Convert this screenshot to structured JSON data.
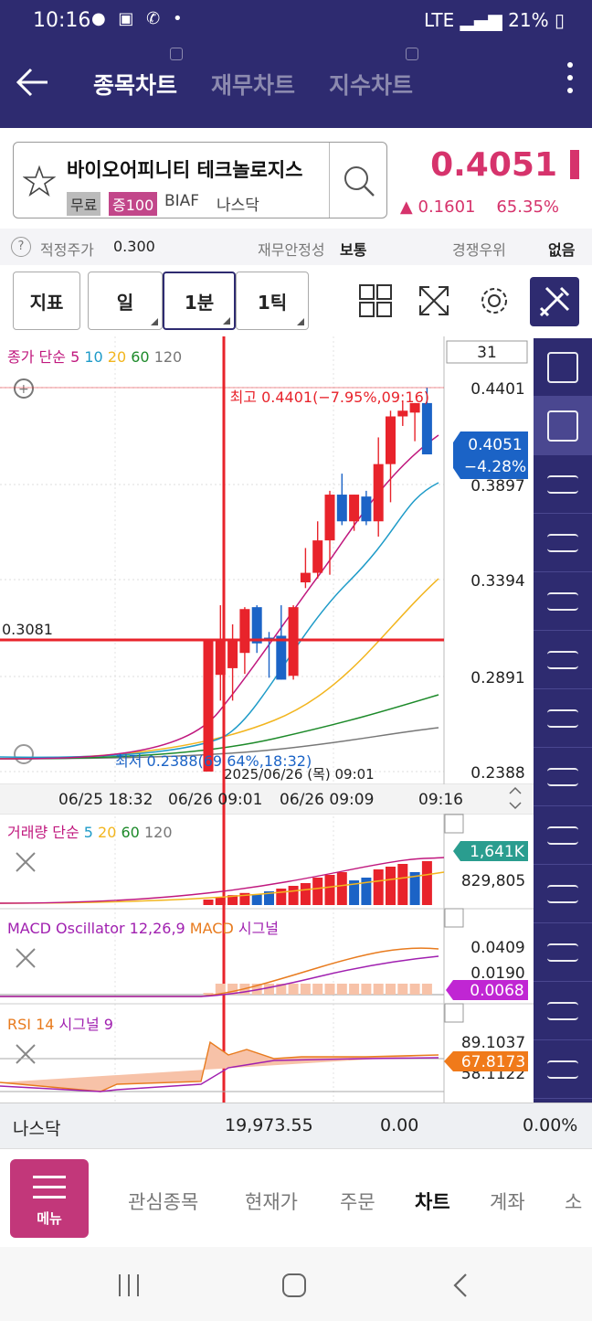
{
  "status_bar": {
    "time": "10:16",
    "battery": "21%",
    "network": "LTE"
  },
  "header": {
    "tabs": [
      {
        "label": "종목차트",
        "active": true
      },
      {
        "label": "재무차트",
        "active": false
      },
      {
        "label": "지수차트",
        "active": false
      }
    ]
  },
  "stock": {
    "name": "바이오어피니티 테크놀로지스",
    "tag_free": "무료",
    "tag_margin": "증100",
    "ticker": "BIAF",
    "market": "나스닥",
    "price": "0.4051",
    "change": "▲ 0.1601",
    "change_pct": "65.35%"
  },
  "info_row": {
    "fair_price_label": "적정주가",
    "fair_price_value": "0.300",
    "stability_label": "재무안정성",
    "stability_value": "보통",
    "rank_label": "경쟁우위",
    "rank_value": "없음"
  },
  "toolbar": {
    "indicator": "지표",
    "day": "일",
    "minute": "1분",
    "tick": "1틱"
  },
  "price_chart": {
    "ma_legend_prefix": "종가 단순",
    "ma_periods": [
      "5",
      "10",
      "20",
      "60",
      "120"
    ],
    "ma_colors": [
      "#c0187e",
      "#1e9bc8",
      "#f2b51e",
      "#1d8a2a",
      "#777777"
    ],
    "count_box": "31",
    "y_labels": [
      "0.4401",
      "0.3897",
      "0.3394",
      "0.2891",
      "0.2388"
    ],
    "cursor_price": "0.3081",
    "high_label": "최고 0.4401(−7.95%,09:16)",
    "low_label": "최저 0.2388(69.64%,18:32)",
    "cursor_datetime": "2025/06/26 (목) 09:01",
    "current_price_tag": "0.4051",
    "current_pct_tag": "−4.28%",
    "x_labels": [
      "06/25 18:32",
      "06/26 09:01",
      "06/26 09:09",
      "09:16"
    ]
  },
  "volume_panel": {
    "legend_prefix": "거래량 단순",
    "ma_periods": [
      "5",
      "20",
      "60",
      "120"
    ],
    "current_tag": "1,641K",
    "y_label": "829,805"
  },
  "macd_panel": {
    "legend": "MACD Oscillator 12,26,9",
    "legend_macd": "MACD",
    "legend_signal": "시그널",
    "y_labels": [
      "0.0409",
      "0.0190"
    ],
    "current_tag": "0.0068"
  },
  "rsi_panel": {
    "legend": "RSI 14",
    "legend_signal": "시그널 9",
    "y_labels": [
      "89.1037",
      "58.1122"
    ],
    "current_tag": "67.8173"
  },
  "index_row": {
    "name": "나스닥",
    "value": "19,973.55",
    "change": "0.00",
    "change_pct": "0.00%"
  },
  "bottom_nav": {
    "menu_label": "메뉴",
    "items": [
      {
        "label": "관심종목",
        "active": false
      },
      {
        "label": "현재가",
        "active": false
      },
      {
        "label": "주문",
        "active": false
      },
      {
        "label": "차트",
        "active": true
      },
      {
        "label": "계좌",
        "active": false
      },
      {
        "label": "소",
        "active": false
      }
    ]
  },
  "rail_icons": [
    "save-icon",
    "eraser-icon",
    "eraser-all-icon",
    "hcl-line-icon",
    "cross-point-icon",
    "peak-icon",
    "valley-icon",
    "trend-line-icon",
    "auto-trend-icon",
    "arc-icon",
    "fan-icon",
    "vertical-lines-icon",
    "channel-icon"
  ],
  "colors": {
    "brand": "#2e2b70",
    "up": "#e8232b",
    "down": "#1b63c6",
    "accent_pink": "#d6336c"
  },
  "chart_data": {
    "type": "candlestick",
    "price_axis": [
      0.2388,
      0.4401
    ],
    "candles": [
      {
        "open": 0.3081,
        "high": 0.3081,
        "low": 0.2388,
        "close": 0.2388,
        "dir": "up"
      },
      {
        "open": 0.2895,
        "high": 0.326,
        "low": 0.276,
        "close": 0.3081,
        "dir": "up"
      },
      {
        "open": 0.293,
        "high": 0.316,
        "low": 0.276,
        "close": 0.3082,
        "dir": "up"
      },
      {
        "open": 0.301,
        "high": 0.325,
        "low": 0.29,
        "close": 0.324,
        "dir": "up"
      },
      {
        "open": 0.325,
        "high": 0.326,
        "low": 0.301,
        "close": 0.306,
        "dir": "down"
      },
      {
        "open": 0.309,
        "high": 0.312,
        "low": 0.288,
        "close": 0.309,
        "dir": "down"
      },
      {
        "open": 0.287,
        "high": 0.326,
        "low": 0.287,
        "close": 0.31,
        "dir": "down"
      },
      {
        "open": 0.289,
        "high": 0.326,
        "low": 0.287,
        "close": 0.325,
        "dir": "up"
      },
      {
        "open": 0.338,
        "high": 0.356,
        "low": 0.335,
        "close": 0.343,
        "dir": "up"
      },
      {
        "open": 0.343,
        "high": 0.37,
        "low": 0.34,
        "close": 0.36,
        "dir": "up"
      },
      {
        "open": 0.36,
        "high": 0.386,
        "low": 0.342,
        "close": 0.384,
        "dir": "up"
      },
      {
        "open": 0.384,
        "high": 0.395,
        "low": 0.368,
        "close": 0.37,
        "dir": "down"
      },
      {
        "open": 0.37,
        "high": 0.384,
        "low": 0.365,
        "close": 0.384,
        "dir": "up"
      },
      {
        "open": 0.383,
        "high": 0.386,
        "low": 0.368,
        "close": 0.37,
        "dir": "down"
      },
      {
        "open": 0.37,
        "high": 0.414,
        "low": 0.362,
        "close": 0.4,
        "dir": "up"
      },
      {
        "open": 0.4,
        "high": 0.428,
        "low": 0.38,
        "close": 0.425,
        "dir": "up"
      },
      {
        "open": 0.425,
        "high": 0.433,
        "low": 0.42,
        "close": 0.428,
        "dir": "up"
      },
      {
        "open": 0.427,
        "high": 0.432,
        "low": 0.412,
        "close": 0.432,
        "dir": "up"
      },
      {
        "open": 0.432,
        "high": 0.4401,
        "low": 0.408,
        "close": 0.4051,
        "dir": "down"
      }
    ],
    "volume_dirs": [
      "up",
      "up",
      "up",
      "up",
      "down",
      "down",
      "up",
      "up",
      "up",
      "up",
      "up",
      "up",
      "down",
      "down",
      "up",
      "up",
      "up",
      "down",
      "up"
    ],
    "volume_levels": [
      0.1,
      0.14,
      0.18,
      0.22,
      0.2,
      0.25,
      0.3,
      0.35,
      0.4,
      0.5,
      0.55,
      0.6,
      0.45,
      0.5,
      0.65,
      0.7,
      0.75,
      0.6,
      0.8
    ]
  }
}
